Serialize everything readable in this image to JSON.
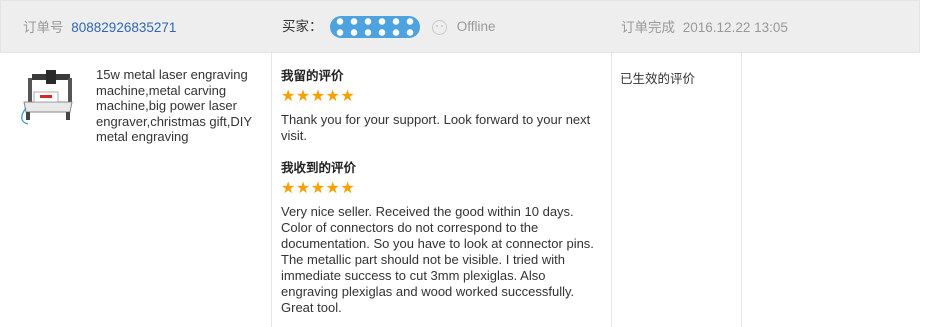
{
  "order": {
    "number_label": "订单号",
    "number": "80882926835271",
    "buyer_label": "买家：",
    "buyer_status": "Offline",
    "complete_label": "订单完成",
    "complete_time": "2016.12.22 13:05"
  },
  "product": {
    "image_icon": "laser-engraver-image",
    "title": "15w metal laser engraving machine,metal carving machine,big power laser engraver,christmas gift,DIY metal engraving"
  },
  "reviews": {
    "my_review": {
      "heading": "我留的评价",
      "stars": 5,
      "text": "Thank you for your support. Look forward to your next visit."
    },
    "received_review": {
      "heading": "我收到的评价",
      "stars": 5,
      "text": "Very nice seller. Received the good within 10 days. Color of connectors do not correspond to the documentation. So you have to look at connector pins. The metallic part should not be visible. I tried with immediate success to cut 3mm plexiglas. Also engraving plexiglas and wood worked successfully. Great tool."
    }
  },
  "review_status": "已生效的评价",
  "colors": {
    "link": "#2f67b3",
    "star": "#f6a100",
    "header_bg": "#eeeeee",
    "buyer_mask": "#4da2e0"
  }
}
